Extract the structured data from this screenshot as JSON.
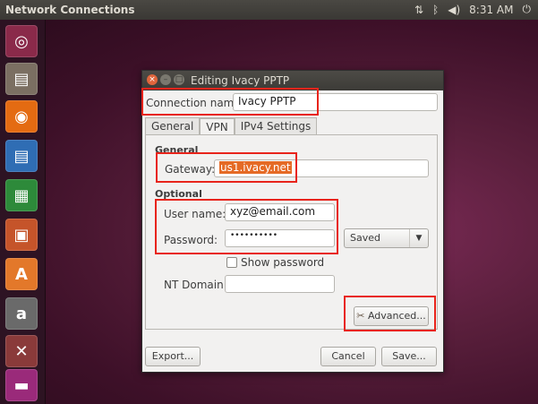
{
  "topbar": {
    "title": "Network Connections",
    "time": "8:31 AM",
    "tray_icons": [
      "network-icon",
      "bluetooth-icon",
      "volume-icon",
      "power-icon"
    ]
  },
  "launcher": {
    "items": [
      {
        "icon": "ubuntu-dash-icon",
        "glyph": "◎",
        "color": "#8a2a4a"
      },
      {
        "icon": "files-icon",
        "glyph": "▤",
        "color": "#7b6f62"
      },
      {
        "icon": "firefox-icon",
        "glyph": "◉",
        "color": "#e46b12"
      },
      {
        "icon": "writer-icon",
        "glyph": "▤",
        "color": "#2f6db4"
      },
      {
        "icon": "calc-icon",
        "glyph": "▦",
        "color": "#2d8a3a"
      },
      {
        "icon": "impress-icon",
        "glyph": "▣",
        "color": "#c5542a"
      },
      {
        "icon": "software-center-icon",
        "glyph": "A",
        "color": "#e3782a"
      },
      {
        "icon": "amazon-icon",
        "glyph": "a",
        "color": "#6a6a6a"
      },
      {
        "icon": "system-settings-icon",
        "glyph": "✕",
        "color": "#8a3a3a"
      },
      {
        "icon": "network-app-icon",
        "glyph": "▬",
        "color": "#9a2a7a"
      }
    ]
  },
  "dialog": {
    "title": "Editing Ivacy PPTP",
    "connection_name_label": "Connection name:",
    "connection_name_value": "Ivacy PPTP",
    "tabs": [
      {
        "label": "General",
        "active": false
      },
      {
        "label": "VPN",
        "active": true
      },
      {
        "label": "IPv4 Settings",
        "active": false
      }
    ],
    "general_section": "General",
    "gateway_label": "Gateway:",
    "gateway_value": "us1.ivacy.net",
    "optional_section": "Optional",
    "username_label": "User name:",
    "username_value": "xyz@email.com",
    "password_label": "Password:",
    "password_value": "••••••••••",
    "password_storage": "Saved",
    "show_password_label": "Show password",
    "show_password_checked": false,
    "nt_domain_label": "NT Domain:",
    "nt_domain_value": "",
    "advanced_button": "Advanced...",
    "export_button": "Export...",
    "cancel_button": "Cancel",
    "save_button": "Save..."
  },
  "colors": {
    "highlight_box": "#e8241b",
    "selection": "#e56a25"
  }
}
